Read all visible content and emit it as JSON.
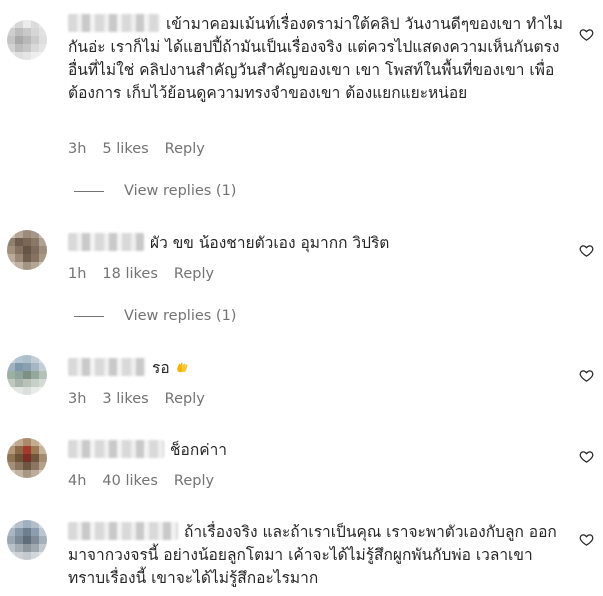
{
  "comments": [
    {
      "text": "เข้ามาคอมเม้นท์เรื่องดราม่าใต้คลิป วันงานดีๆของเขา ทำไมกันอ่ะ เราก็ไม่ ได้แฮปปี้ถ้ามันเป็นเรื่องจริง แต่ควรไปแสดงความเห็นกันตรงอื่นที่ไม่ใช่ คลิปงานสำคัญวันสำคัญของเขา เขา โพสท์ในพื้นที่ของเขา เพื่อต้องการ เก็บไว้ย้อนดูความทรงจำของเขา ต้องแยกแยะหน่อย",
      "time": "3h",
      "likes": "5 likes",
      "reply": "Reply",
      "view_replies": "View replies (1)",
      "avatar_colors": [
        "#e6e6e6",
        "#d8d8d8",
        "#ececec",
        "#dcdcdc",
        "#e8e8e8",
        "#cfcfcf",
        "#bdbdbd",
        "#c9c9c9",
        "#d6d6d6",
        "#e1e1e1",
        "#c4c4c4",
        "#a9a9a9",
        "#b8b8b8",
        "#cbcbcb",
        "#dedede",
        "#d2d2d2",
        "#bcbcbc",
        "#c6c6c6",
        "#d9d9d9",
        "#e4e4e4",
        "#ebebeb",
        "#dfdfdf",
        "#e5e5e5",
        "#eeeeee",
        "#f0f0f0"
      ]
    },
    {
      "text": "ผัว ขข น้องชายตัวเอง อุมากก วิปริต",
      "time": "1h",
      "likes": "18 likes",
      "reply": "Reply",
      "view_replies": "View replies (1)",
      "avatar_colors": [
        "#cbbfb3",
        "#b5a597",
        "#9c8b7c",
        "#a5968a",
        "#c9bcb1",
        "#8f7f70",
        "#6e5c4c",
        "#7a6756",
        "#8a7866",
        "#b0a293",
        "#a18f7c",
        "#847160",
        "#665445",
        "#7d6b5b",
        "#9e8c7a",
        "#b9aa99",
        "#9a8877",
        "#6f5e4f",
        "#85735f",
        "#a89886",
        "#d5c9bd",
        "#bfb1a3",
        "#a49483",
        "#b4a594",
        "#cdc1b4"
      ]
    },
    {
      "text": "รอ",
      "emoji": "raised-hands-emoji",
      "time": "3h",
      "likes": "3 likes",
      "reply": "Reply",
      "avatar_colors": [
        "#c9d3dc",
        "#b6c4cf",
        "#aebfcc",
        "#c0ccd6",
        "#d3dce3",
        "#9fb2c1",
        "#7f98ab",
        "#8aa0b1",
        "#a6b7c4",
        "#c3ced7",
        "#9bb0a3",
        "#8fa49a",
        "#7c9083",
        "#94a89c",
        "#b3c2b8",
        "#bfc9bf",
        "#a9b5ab",
        "#b8c2b9",
        "#c7d0c8",
        "#d4dbd5",
        "#dfe4e0",
        "#e4e8e5",
        "#d9dfda",
        "#e8ece9",
        "#eef1ef"
      ]
    },
    {
      "text": "ช็อกค่าา",
      "time": "4h",
      "likes": "40 likes",
      "reply": "Reply",
      "avatar_colors": [
        "#cdbfae",
        "#bfa88e",
        "#a98a6a",
        "#c4ad93",
        "#d8ccbf",
        "#b59676",
        "#8c6a4a",
        "#a23b2e",
        "#9c7a58",
        "#c6b29c",
        "#8e7355",
        "#6d5238",
        "#7a2e24",
        "#6f563d",
        "#a38b72",
        "#a58f78",
        "#8b7560",
        "#6b5744",
        "#8c7661",
        "#b4a08b",
        "#d2c6b9",
        "#c2b3a2",
        "#a99784",
        "#bcac99",
        "#d6cbbf"
      ]
    },
    {
      "text": "ถ้าเรื่องจริง และถ้าเราเป็นคุณ เราจะพาตัวเองกับลูก ออกมาจากวงจรนี้ อย่างน้อยลูกโตมา เค้าจะได้ไม่รู้สึกผูกพันกับพ่อ เวลาเขาทราบเรื่องนี้ เขาจะได้ไม่รู้สึกอะไรมาก",
      "time": "",
      "likes": "",
      "reply": "",
      "avatar_colors": [
        "#c8d2dc",
        "#b7c2cd",
        "#9fb0c0",
        "#b2bfcb",
        "#d0d8e0",
        "#aab6c2",
        "#8798a8",
        "#6e7f90",
        "#8e9eae",
        "#bcc6d0",
        "#9aa6b2",
        "#7b8896",
        "#5f6c79",
        "#7f8b97",
        "#a6b0ba",
        "#b9c1c9",
        "#a3abb3",
        "#8d959d",
        "#a0a8b0",
        "#c1c8cf",
        "#d7dce1",
        "#cdd2d7",
        "#c3c9ce",
        "#d2d7dc",
        "#e2e6e9"
      ]
    }
  ],
  "icons": {
    "heart": "heart-outline-icon"
  }
}
